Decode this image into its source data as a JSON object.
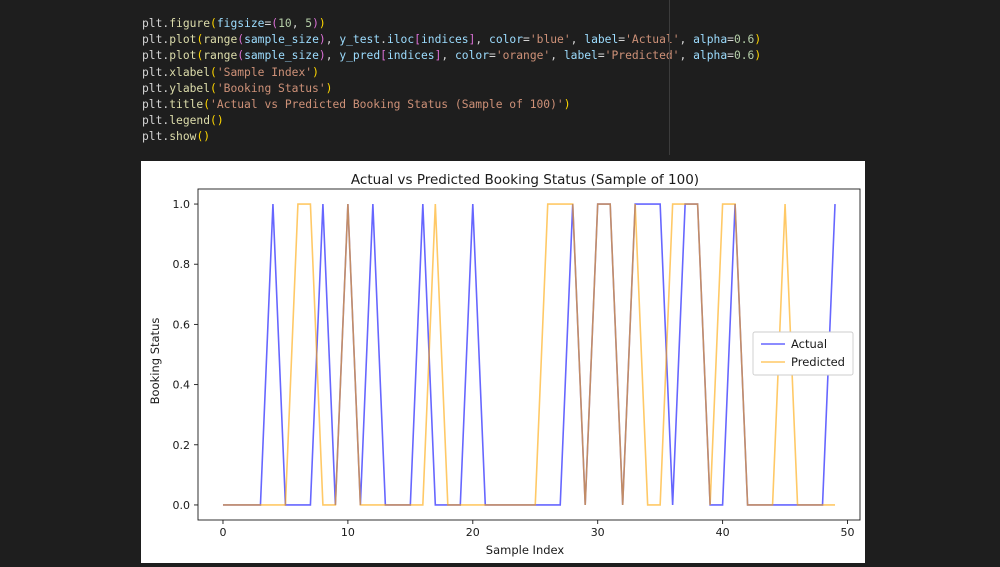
{
  "code": {
    "lines": [
      [
        {
          "t": "plt",
          "c": "tk-p"
        },
        {
          "t": ".",
          "c": "tk-p"
        },
        {
          "t": "figure",
          "c": "tk-fn"
        },
        {
          "t": "(",
          "c": "tk-paren"
        },
        {
          "t": "figsize",
          "c": "tk-var"
        },
        {
          "t": "=",
          "c": "tk-p"
        },
        {
          "t": "(",
          "c": "tk-brk"
        },
        {
          "t": "10",
          "c": "tk-num"
        },
        {
          "t": ", ",
          "c": "tk-p"
        },
        {
          "t": "5",
          "c": "tk-num"
        },
        {
          "t": ")",
          "c": "tk-brk"
        },
        {
          "t": ")",
          "c": "tk-paren"
        }
      ],
      [
        {
          "t": "plt",
          "c": "tk-p"
        },
        {
          "t": ".",
          "c": "tk-p"
        },
        {
          "t": "plot",
          "c": "tk-fn"
        },
        {
          "t": "(",
          "c": "tk-paren"
        },
        {
          "t": "range",
          "c": "tk-fn"
        },
        {
          "t": "(",
          "c": "tk-brk"
        },
        {
          "t": "sample_size",
          "c": "tk-var"
        },
        {
          "t": ")",
          "c": "tk-brk"
        },
        {
          "t": ", ",
          "c": "tk-p"
        },
        {
          "t": "y_test",
          "c": "tk-var"
        },
        {
          "t": ".",
          "c": "tk-p"
        },
        {
          "t": "iloc",
          "c": "tk-var"
        },
        {
          "t": "[",
          "c": "tk-brk"
        },
        {
          "t": "indices",
          "c": "tk-var"
        },
        {
          "t": "]",
          "c": "tk-brk"
        },
        {
          "t": ", ",
          "c": "tk-p"
        },
        {
          "t": "color",
          "c": "tk-var"
        },
        {
          "t": "=",
          "c": "tk-p"
        },
        {
          "t": "'blue'",
          "c": "tk-str"
        },
        {
          "t": ", ",
          "c": "tk-p"
        },
        {
          "t": "label",
          "c": "tk-var"
        },
        {
          "t": "=",
          "c": "tk-p"
        },
        {
          "t": "'Actual'",
          "c": "tk-str"
        },
        {
          "t": ", ",
          "c": "tk-p"
        },
        {
          "t": "alpha",
          "c": "tk-var"
        },
        {
          "t": "=",
          "c": "tk-p"
        },
        {
          "t": "0.6",
          "c": "tk-num"
        },
        {
          "t": ")",
          "c": "tk-paren"
        }
      ],
      [
        {
          "t": "plt",
          "c": "tk-p"
        },
        {
          "t": ".",
          "c": "tk-p"
        },
        {
          "t": "plot",
          "c": "tk-fn"
        },
        {
          "t": "(",
          "c": "tk-paren"
        },
        {
          "t": "range",
          "c": "tk-fn"
        },
        {
          "t": "(",
          "c": "tk-brk"
        },
        {
          "t": "sample_size",
          "c": "tk-var"
        },
        {
          "t": ")",
          "c": "tk-brk"
        },
        {
          "t": ", ",
          "c": "tk-p"
        },
        {
          "t": "y_pred",
          "c": "tk-var"
        },
        {
          "t": "[",
          "c": "tk-brk"
        },
        {
          "t": "indices",
          "c": "tk-var"
        },
        {
          "t": "]",
          "c": "tk-brk"
        },
        {
          "t": ", ",
          "c": "tk-p"
        },
        {
          "t": "color",
          "c": "tk-var"
        },
        {
          "t": "=",
          "c": "tk-p"
        },
        {
          "t": "'orange'",
          "c": "tk-str"
        },
        {
          "t": ", ",
          "c": "tk-p"
        },
        {
          "t": "label",
          "c": "tk-var"
        },
        {
          "t": "=",
          "c": "tk-p"
        },
        {
          "t": "'Predicted'",
          "c": "tk-str"
        },
        {
          "t": ", ",
          "c": "tk-p"
        },
        {
          "t": "alpha",
          "c": "tk-var"
        },
        {
          "t": "=",
          "c": "tk-p"
        },
        {
          "t": "0.6",
          "c": "tk-num"
        },
        {
          "t": ")",
          "c": "tk-paren"
        }
      ],
      [
        {
          "t": "plt",
          "c": "tk-p"
        },
        {
          "t": ".",
          "c": "tk-p"
        },
        {
          "t": "xlabel",
          "c": "tk-fn"
        },
        {
          "t": "(",
          "c": "tk-paren"
        },
        {
          "t": "'Sample Index'",
          "c": "tk-str"
        },
        {
          "t": ")",
          "c": "tk-paren"
        }
      ],
      [
        {
          "t": "plt",
          "c": "tk-p"
        },
        {
          "t": ".",
          "c": "tk-p"
        },
        {
          "t": "ylabel",
          "c": "tk-fn"
        },
        {
          "t": "(",
          "c": "tk-paren"
        },
        {
          "t": "'Booking Status'",
          "c": "tk-str"
        },
        {
          "t": ")",
          "c": "tk-paren"
        }
      ],
      [
        {
          "t": "plt",
          "c": "tk-p"
        },
        {
          "t": ".",
          "c": "tk-p"
        },
        {
          "t": "title",
          "c": "tk-fn"
        },
        {
          "t": "(",
          "c": "tk-paren"
        },
        {
          "t": "'Actual vs Predicted Booking Status (Sample of 100)'",
          "c": "tk-str"
        },
        {
          "t": ")",
          "c": "tk-paren"
        }
      ],
      [
        {
          "t": "plt",
          "c": "tk-p"
        },
        {
          "t": ".",
          "c": "tk-p"
        },
        {
          "t": "legend",
          "c": "tk-fn"
        },
        {
          "t": "()",
          "c": "tk-paren"
        }
      ],
      [
        {
          "t": "plt",
          "c": "tk-p"
        },
        {
          "t": ".",
          "c": "tk-p"
        },
        {
          "t": "show",
          "c": "tk-fn"
        },
        {
          "t": "()",
          "c": "tk-paren"
        }
      ]
    ]
  },
  "chart_data": {
    "type": "line",
    "title": "Actual vs Predicted Booking Status (Sample of 100)",
    "xlabel": "Sample Index",
    "ylabel": "Booking Status",
    "xlim": [
      -2,
      51
    ],
    "ylim": [
      -0.05,
      1.05
    ],
    "xticks": [
      0,
      10,
      20,
      30,
      40,
      50
    ],
    "yticks": [
      0.0,
      0.2,
      0.4,
      0.6,
      0.8,
      1.0
    ],
    "xtick_labels": [
      "0",
      "10",
      "20",
      "30",
      "40",
      "50"
    ],
    "ytick_labels": [
      "0.0",
      "0.2",
      "0.4",
      "0.6",
      "0.8",
      "1.0"
    ],
    "legend_position": "center-right",
    "series": [
      {
        "name": "Actual",
        "color": "#0000ff",
        "alpha": 0.6,
        "x": [
          0,
          1,
          2,
          3,
          4,
          5,
          6,
          7,
          8,
          9,
          10,
          11,
          12,
          13,
          14,
          15,
          16,
          17,
          18,
          19,
          20,
          21,
          22,
          23,
          24,
          25,
          26,
          27,
          28,
          29,
          30,
          31,
          32,
          33,
          34,
          35,
          36,
          37,
          38,
          39,
          40,
          41,
          42,
          43,
          44,
          45,
          46,
          47,
          48,
          49
        ],
        "values": [
          0,
          0,
          0,
          0,
          1,
          0,
          0,
          0,
          1,
          0,
          1,
          0,
          1,
          0,
          0,
          0,
          1,
          0,
          0,
          0,
          1,
          0,
          0,
          0,
          0,
          0,
          0,
          0,
          1,
          0,
          1,
          1,
          0,
          1,
          1,
          1,
          0,
          1,
          1,
          0,
          0,
          1,
          0,
          0,
          0,
          0,
          0,
          0,
          0,
          1
        ]
      },
      {
        "name": "Predicted",
        "color": "#ffa500",
        "alpha": 0.6,
        "x": [
          0,
          1,
          2,
          3,
          4,
          5,
          6,
          7,
          8,
          9,
          10,
          11,
          12,
          13,
          14,
          15,
          16,
          17,
          18,
          19,
          20,
          21,
          22,
          23,
          24,
          25,
          26,
          27,
          28,
          29,
          30,
          31,
          32,
          33,
          34,
          35,
          36,
          37,
          38,
          39,
          40,
          41,
          42,
          43,
          44,
          45,
          46,
          47,
          48,
          49
        ],
        "values": [
          0,
          0,
          0,
          0,
          0,
          0,
          1,
          1,
          0,
          0,
          1,
          0,
          0,
          0,
          0,
          0,
          0,
          1,
          0,
          0,
          0,
          0,
          0,
          0,
          0,
          0,
          1,
          1,
          1,
          0,
          1,
          1,
          0,
          1,
          0,
          0,
          1,
          1,
          1,
          0,
          1,
          1,
          0,
          0,
          0,
          1,
          0,
          0,
          0,
          0
        ]
      }
    ]
  }
}
